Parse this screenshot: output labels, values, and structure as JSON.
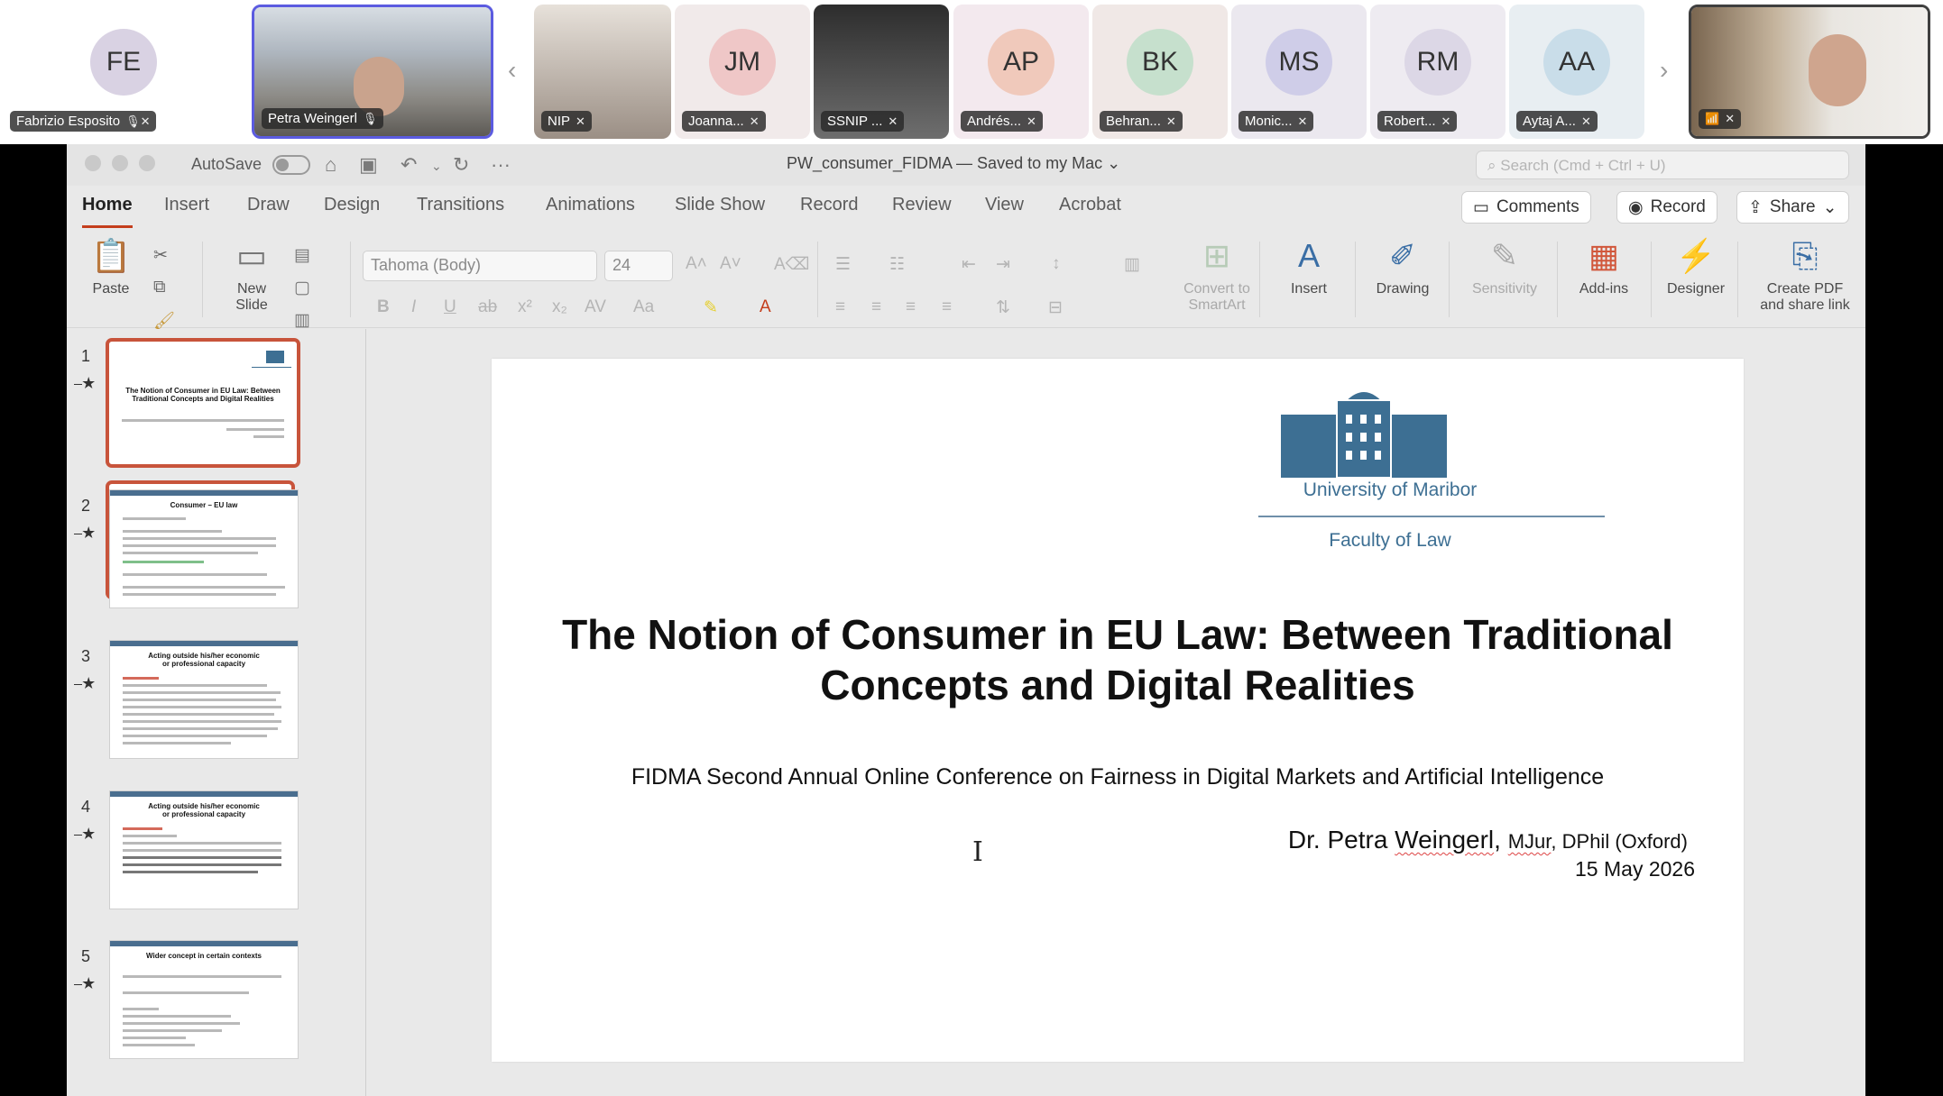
{
  "participants": [
    {
      "initials": "FE",
      "name": "Fabrizio Esposito",
      "color": "#ddd6e6"
    },
    {
      "initials": "",
      "name": "Petra Weingerl",
      "color": "#8a8f95"
    },
    {
      "initials": "",
      "name": "NIP",
      "color": "#b7ada3"
    },
    {
      "initials": "JM",
      "name": "Joanna...",
      "color": "#f0c4c4"
    },
    {
      "initials": "",
      "name": "SSNIP ...",
      "color": "#4a4a4a"
    },
    {
      "initials": "AP",
      "name": "Andrés...",
      "color": "#f0c6b8"
    },
    {
      "initials": "BK",
      "name": "Behran...",
      "color": "#c5e0cc"
    },
    {
      "initials": "MS",
      "name": "Monic...",
      "color": "#cfcde8"
    },
    {
      "initials": "RM",
      "name": "Robert...",
      "color": "#ddd8e6"
    },
    {
      "initials": "AA",
      "name": "Aytaj A...",
      "color": "#c9dde9"
    },
    {
      "initials": "",
      "name": "",
      "color": "#cfc8bd"
    }
  ],
  "window": {
    "autosave": "AutoSave",
    "doc_title": "PW_consumer_FIDMA — Saved to my Mac ⌄",
    "search_placeholder": "Search (Cmd + Ctrl + U)"
  },
  "tabs": [
    "Home",
    "Insert",
    "Draw",
    "Design",
    "Transitions",
    "Animations",
    "Slide Show",
    "Record",
    "Review",
    "View",
    "Acrobat"
  ],
  "top_buttons": {
    "comments": "Comments",
    "record": "Record",
    "share": "Share"
  },
  "ribbon": {
    "paste": "Paste",
    "new_slide": "New\nSlide",
    "font_name": "Tahoma (Body)",
    "font_size": "24",
    "convert": "Convert to\nSmartArt",
    "insert": "Insert",
    "drawing": "Drawing",
    "sensitivity": "Sensitivity",
    "addins": "Add-ins",
    "designer": "Designer",
    "create_pdf": "Create PDF\nand share link"
  },
  "thumbnails": [
    {
      "num": "1",
      "title": "The Notion of Consumer in EU Law: Between Traditional Concepts and Digital Realities"
    },
    {
      "num": "2",
      "title": "Consumer – EU law"
    },
    {
      "num": "3",
      "title": "Acting outside his/her economic or professional capacity"
    },
    {
      "num": "4",
      "title": "Acting outside his/her economic or professional capacity"
    },
    {
      "num": "5",
      "title": "Wider concept in certain contexts"
    }
  ],
  "slide": {
    "university": "University of Maribor",
    "faculty": "Faculty of Law",
    "title": "The Notion of Consumer in EU Law: Between Traditional Concepts and Digital Realities",
    "subtitle": "FIDMA Second Annual Online Conference on Fairness in Digital Markets and Artificial Intelligence",
    "author_prefix": "Dr. Petra ",
    "author_last": "Weingerl",
    "author_comma": ",",
    "deg1": "MJur",
    "deg2": ", DPhil (Oxford)",
    "date": "15 May 2026"
  }
}
